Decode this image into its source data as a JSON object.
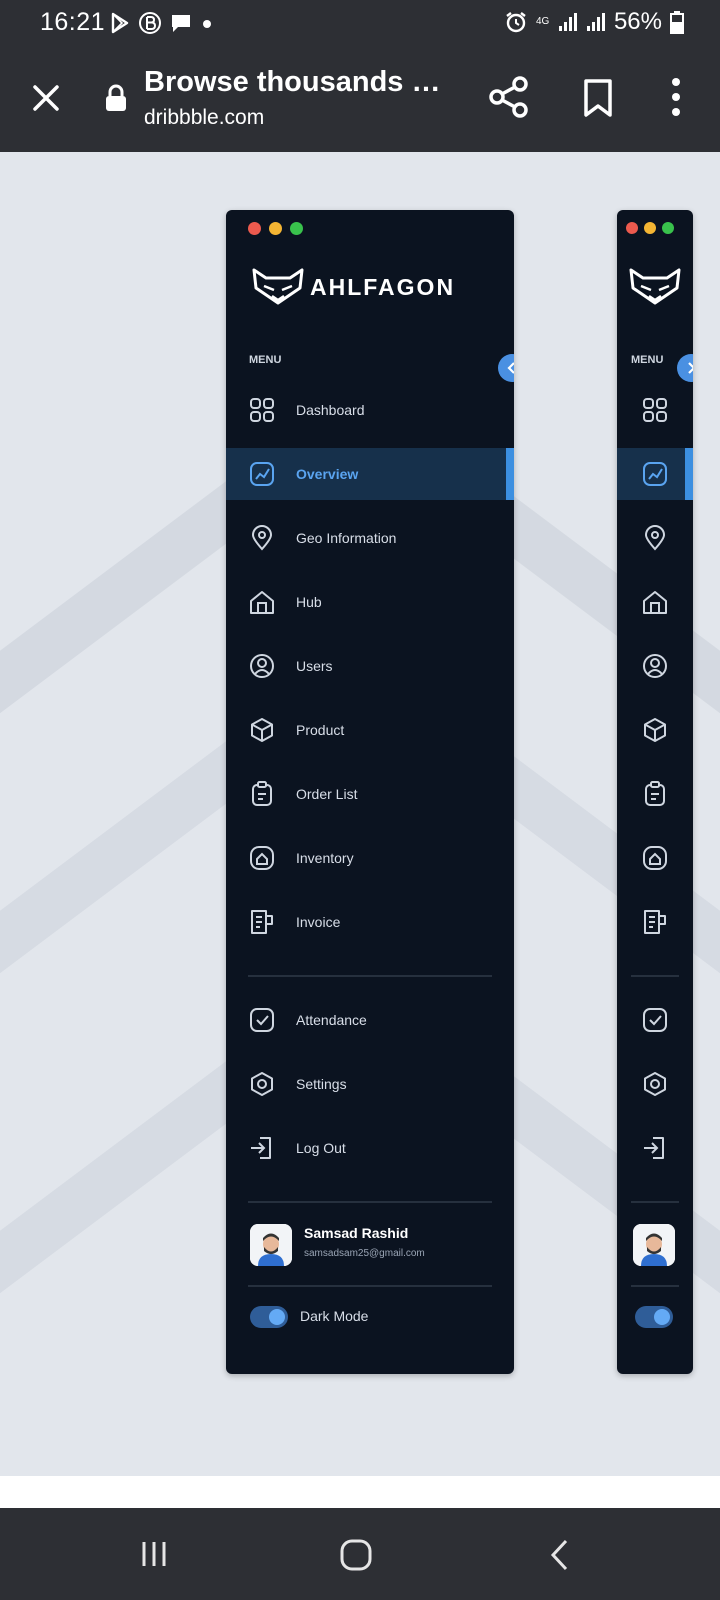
{
  "status_bar": {
    "time": "16:21",
    "battery": "56%",
    "network": "4G",
    "icons_left": [
      "play-store-icon",
      "b-badge-icon",
      "message-icon",
      "dot-icon"
    ],
    "icons_right": [
      "alarm-icon",
      "network-4g-icon",
      "signal-icon",
      "signal-icon",
      "battery-icon"
    ]
  },
  "browser": {
    "page_title": "Browse thousands o...",
    "domain": "dribbble.com",
    "icons": [
      "close-icon",
      "lock-icon",
      "share-icon",
      "bookmark-icon",
      "more-vertical-icon"
    ]
  },
  "sidebar": {
    "window_dots": [
      "#ec5a4e",
      "#f4b533",
      "#39c24c"
    ],
    "brand": "AHLFAGON",
    "menu_label": "MENU",
    "accent_color": "#4a90e2",
    "items": [
      {
        "label": "Dashboard",
        "icon": "grid-icon",
        "active": false
      },
      {
        "label": "Overview",
        "icon": "chart-square-icon",
        "active": true
      },
      {
        "label": "Geo Information",
        "icon": "location-pin-icon",
        "active": false
      },
      {
        "label": "Hub",
        "icon": "home-icon",
        "active": false
      },
      {
        "label": "Users",
        "icon": "user-circle-icon",
        "active": false
      },
      {
        "label": "Product",
        "icon": "box-icon",
        "active": false
      },
      {
        "label": "Order List",
        "icon": "clipboard-icon",
        "active": false
      },
      {
        "label": "Inventory",
        "icon": "inventory-icon",
        "active": false
      },
      {
        "label": "Invoice",
        "icon": "invoice-icon",
        "active": false
      }
    ],
    "secondary_items": [
      {
        "label": "Attendance",
        "icon": "check-square-icon"
      },
      {
        "label": "Settings",
        "icon": "settings-hex-icon"
      },
      {
        "label": "Log Out",
        "icon": "logout-icon"
      }
    ],
    "user": {
      "name": "Samsad Rashid",
      "email": "samsadsam25@gmail.com"
    },
    "dark_mode_label": "Dark Mode",
    "dark_mode_on": true
  },
  "nav_bar": {
    "icons": [
      "recents-icon",
      "home-button-icon",
      "back-icon"
    ]
  }
}
